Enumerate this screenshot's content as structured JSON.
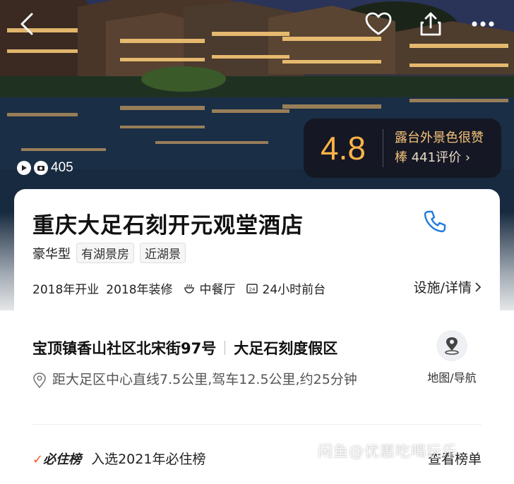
{
  "gallery": {
    "photo_count": "405",
    "icons": {
      "back": "back-arrow-icon",
      "favorite": "heart-icon",
      "share": "share-icon",
      "more": "more-dots-icon",
      "photos": "camera-icon"
    }
  },
  "rating": {
    "score": "4.8",
    "highlight": "露台外景色很赞",
    "tail": "棒",
    "review_count": "441评价",
    "chevron": "›",
    "accent_color": "#ffb347"
  },
  "hotel": {
    "name": "重庆大足石刻开元观堂酒店",
    "type": "豪华型",
    "tags": [
      "有湖景房",
      "近湖景"
    ]
  },
  "facilities": {
    "opened": "2018年开业",
    "renovated": "2018年装修",
    "restaurant": "中餐厅",
    "front_desk": "24小时前台",
    "detail_link": "设施/详情"
  },
  "location": {
    "address": "宝顶镇香山社区北宋街97号",
    "area": "大足石刻度假区",
    "distance": "距大足区中心直线7.5公里,驾车12.5公里,约25分钟",
    "map_label": "地图/导航"
  },
  "must_stay": {
    "logo": "必住榜",
    "text": "入选2021年必住榜",
    "link": "查看榜单"
  },
  "watermark": "闲鱼@优惠吃喝玩乐"
}
